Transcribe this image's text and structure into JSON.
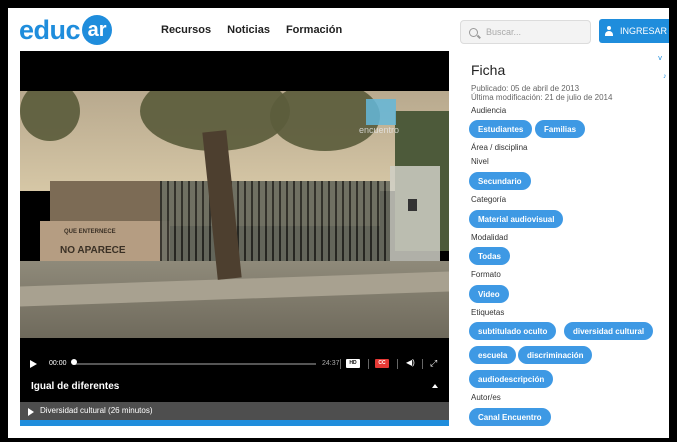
{
  "header": {
    "logo_text": "educ",
    "logo_badge": "ar",
    "nav": [
      "Recursos",
      "Noticias",
      "Formación"
    ],
    "search_placeholder": "Buscar...",
    "login_label": "INGRESAR"
  },
  "player": {
    "channel_name": "encuentro",
    "graffiti_1": "QUE ENTERNECE",
    "graffiti_2": "NO APARECE",
    "time_current": "00:00",
    "time_total": "24:37",
    "progress": 0,
    "hd_label": "HD",
    "cc_label": "CC",
    "title": "Igual de diferentes",
    "playlist_item": "Diversidad cultural (26 minutos)"
  },
  "ficha": {
    "title": "Ficha",
    "published": "Publicado: 05 de abril de 2013",
    "modified": "Última modificación: 21 de julio de 2014",
    "sections": {
      "audiencia": "Audiencia",
      "area": "Área / disciplina",
      "nivel": "Nivel",
      "categoria": "Categoría",
      "modalidad": "Modalidad",
      "formato": "Formato",
      "etiquetas": "Etiquetas",
      "autor": "Autor/es"
    },
    "audiencia_tags": [
      "Estudiantes",
      "Familias"
    ],
    "nivel_tags": [
      "Secundario"
    ],
    "categoria_tags": [
      "Material audiovisual"
    ],
    "modalidad_tags": [
      "Todas"
    ],
    "formato_tags": [
      "Video"
    ],
    "etiquetas_tags": [
      "subtitulado oculto",
      "diversidad cultural",
      "escuela",
      "discriminación",
      "audiodescripción"
    ],
    "autor_tags": [
      "Canal Encuentro"
    ]
  },
  "colors": {
    "brand": "#1f8ddc",
    "tag": "#3e99e4"
  }
}
